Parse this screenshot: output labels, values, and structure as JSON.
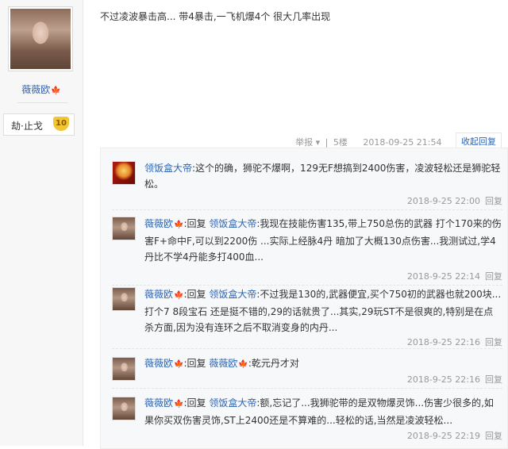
{
  "author": {
    "name": "薇薇欧",
    "maple_icon": "maple-leaf-icon",
    "rank_title": "劫·止戈",
    "level": "10"
  },
  "post": {
    "content": "不过凌波暴击高... 带4暴击,一飞机爆4个 很大几率出现",
    "report_label": "举报",
    "floor": "5楼",
    "time": "2018-09-25 21:54",
    "collapse_label": "收起回复",
    "separator": "|"
  },
  "comments": [
    {
      "user": "领饭盒大帝",
      "avatar": "red-avatar",
      "reply_word": "",
      "reply_to": "",
      "text": ":这个的确，狮驼不爆啊，129无F想搞到2400伤害，凌波轻松还是狮驼轻松。",
      "time": "2018-9-25 22:00",
      "reply": "回复"
    },
    {
      "user": "薇薇欧",
      "avatar": "girl-avatar",
      "reply_word": ":回复",
      "reply_to": "领饭盒大帝",
      "text": ":我现在技能伤害135,带上750总伤的武器 打个170来的伤害F+命中F,可以到2200伤 ...实际上经脉4丹 暗加了大概130点伤害...我测试过,学4丹比不学4丹能多打400血...",
      "time": "2018-9-25 22:14",
      "reply": "回复"
    },
    {
      "user": "薇薇欧",
      "avatar": "girl-avatar",
      "reply_word": ":回复",
      "reply_to": "领饭盒大帝",
      "text": ":不过我是130的,武器便宜,买个750初的武器也就200块...打个7 8段宝石 还是挺不错的,29的话就贵了...其实,29玩ST不是很爽的,特别是在点杀方面,因为没有连环之后不取消变身的内丹...",
      "time": "2018-9-25 22:16",
      "reply": "回复"
    },
    {
      "user": "薇薇欧",
      "avatar": "girl-avatar",
      "reply_word": ":回复",
      "reply_to": "薇薇欧",
      "text": ":乾元丹才对",
      "time": "2018-9-25 22:16",
      "reply": "回复"
    },
    {
      "user": "薇薇欧",
      "avatar": "girl-avatar",
      "reply_word": ":回复",
      "reply_to": "领饭盒大帝",
      "text": ":额,忘记了...我狮驼带的是双物爆灵饰...伤害少很多的,如果你买双伤害灵饰,ST上2400还是不算难的...轻松的话,当然是凌波轻松...",
      "time": "2018-9-25 22:19",
      "reply": "回复"
    }
  ]
}
